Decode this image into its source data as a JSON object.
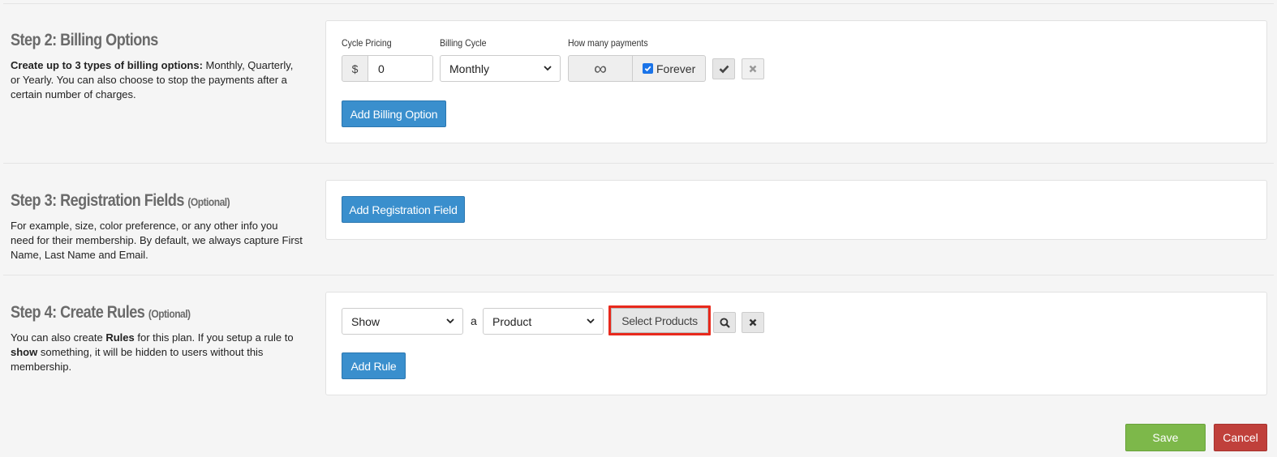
{
  "step2": {
    "title": "Step 2: Billing Options",
    "desc_bold": "Create up to 3 types of billing options:",
    "desc_rest": " Monthly, Quarterly, or Yearly. You can also choose to stop the payments after a certain number of charges.",
    "cycle_pricing_label": "Cycle Pricing",
    "currency_symbol": "$",
    "price_value": "0",
    "billing_cycle_label": "Billing Cycle",
    "billing_cycle_value": "Monthly",
    "payments_label": "How many payments",
    "infinity_symbol": "∞",
    "forever_label": "Forever",
    "forever_checked": true,
    "add_button": "Add Billing Option"
  },
  "step3": {
    "title": "Step 3: Registration Fields",
    "optional": "(Optional)",
    "desc": "For example, size, color preference, or any other info you need for their membership. By default, we always capture First Name, Last Name and Email.",
    "add_button": "Add Registration Field"
  },
  "step4": {
    "title": "Step 4: Create Rules",
    "optional": "(Optional)",
    "desc_1": "You can also create ",
    "desc_rules": "Rules",
    "desc_2": " for this plan. If you setup a rule to ",
    "desc_show": "show",
    "desc_3": " something, it will be hidden to users without this membership.",
    "action_value": "Show",
    "article": "a",
    "type_value": "Product",
    "select_products_button": "Select Products",
    "add_button": "Add Rule"
  },
  "footer": {
    "save_label": "Save",
    "cancel_label": "Cancel"
  },
  "colors": {
    "primary": "#3a8fcd",
    "save": "#7db84a",
    "cancel": "#c0403b",
    "highlight": "#e8291c"
  }
}
